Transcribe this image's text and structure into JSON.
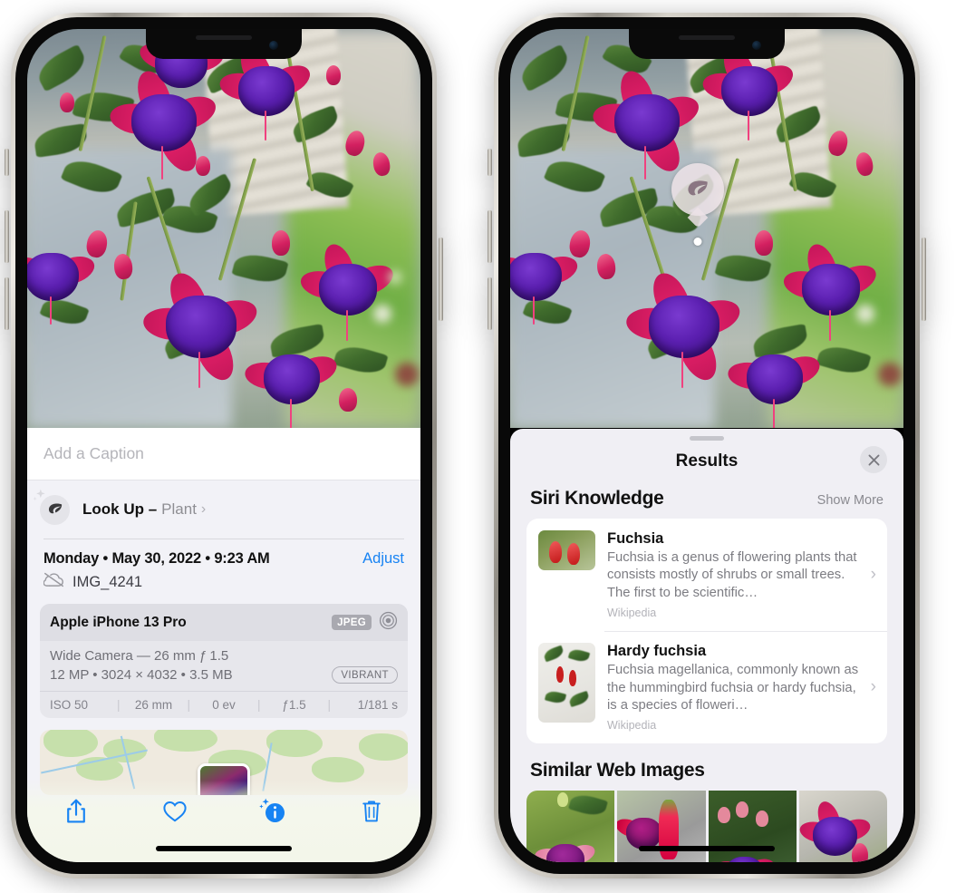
{
  "left_phone": {
    "name": "photos-detail-screen",
    "photo": {
      "alt": "fuchsia-flowers-hanging-basket"
    },
    "caption": {
      "placeholder": "Add a Caption",
      "value": ""
    },
    "lookup": {
      "icon": "leaf-icon",
      "sparkle_icon": "sparkle-icon",
      "label": "Look Up –",
      "value": "Plant",
      "chevron": "›"
    },
    "date_row": {
      "date": "Monday • May 30, 2022 • 9:23 AM",
      "adjust_label": "Adjust"
    },
    "file_row": {
      "icon": "icloud-slash-icon",
      "filename": "IMG_4241"
    },
    "meta_card": {
      "device": "Apple iPhone 13 Pro",
      "format_badge": "JPEG",
      "aperture_icon": "camera-lens-icon",
      "lens_line": "Wide Camera — 26 mm ƒ 1.5",
      "size_line": "12 MP • 3024 × 4032 • 3.5 MB",
      "vibrant_badge": "VIBRANT",
      "exif": [
        "ISO 50",
        "26 mm",
        "0 ev",
        "ƒ1.5",
        "1/181 s"
      ]
    },
    "map": {
      "name": "location-map-thumbnail"
    },
    "toolbar": [
      {
        "name": "share-button",
        "icon": "share-icon"
      },
      {
        "name": "favorite-button",
        "icon": "heart-icon"
      },
      {
        "name": "info-button",
        "icon": "info-sparkle-icon"
      },
      {
        "name": "delete-button",
        "icon": "trash-icon"
      }
    ]
  },
  "right_phone": {
    "name": "visual-look-up-results-screen",
    "marker": {
      "icon": "leaf-icon",
      "name": "visual-lookup-badge"
    },
    "sheet": {
      "title": "Results",
      "close_icon": "close-icon",
      "grabber": "sheet-grabber"
    },
    "siri_knowledge": {
      "title": "Siri Knowledge",
      "action": "Show More",
      "items": [
        {
          "title": "Fuchsia",
          "description": "Fuchsia is a genus of flowering plants that consists mostly of shrubs or small trees. The first to be scientific…",
          "source": "Wikipedia",
          "thumb": "fuchsia-red-flowers-thumb",
          "chevron": "›"
        },
        {
          "title": "Hardy fuchsia",
          "description": "Fuchsia magellanica, commonly known as the hummingbird fuchsia or hardy fuchsia, is a species of floweri…",
          "source": "Wikipedia",
          "thumb": "hardy-fuchsia-branch-thumb",
          "chevron": "›"
        }
      ]
    },
    "similar_web_images": {
      "title": "Similar Web Images",
      "tiles": [
        {
          "name": "web-image-1",
          "alt": "purple-pink-fuchsia-with-leaves"
        },
        {
          "name": "web-image-2",
          "alt": "red-fuchsia-closeup"
        },
        {
          "name": "web-image-3",
          "alt": "fuchsia-bush-with-buds"
        },
        {
          "name": "web-image-4",
          "alt": "purple-magenta-fuchsia-cluster"
        }
      ]
    }
  },
  "colors": {
    "accent_blue": "#1783f3",
    "sheet_bg": "#f0eff4",
    "card_bg": "#ffffff",
    "meta_card_bg": "#e7e7ec",
    "secondary_text": "#8e8e93",
    "flower_pink": "#e8216b",
    "flower_purple": "#5b1fb0",
    "leaf_green": "#3f6b2c"
  }
}
